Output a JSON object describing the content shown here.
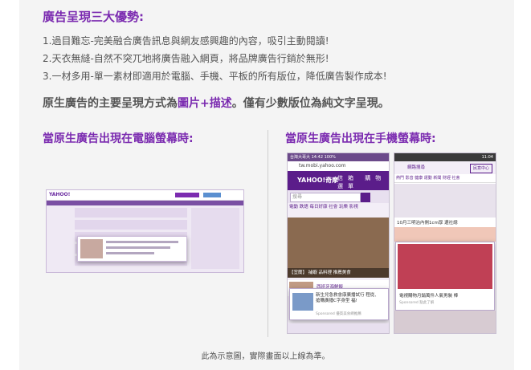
{
  "heading": "廣告呈現三大優勢:",
  "advantages": [
    "1.過目難忘-完美融合廣告訊息與網友感興趣的內容，吸引主動閱讀!",
    "2.天衣無縫-自然不突兀地將廣告融入網頁，將品牌廣告行銷於無形!",
    "3.一材多用-單一素材即適用於電腦、手機、平板的所有版位，降低廣告製作成本!"
  ],
  "summary": {
    "prefix": "原生廣告的主要呈現方式為",
    "highlight": "圖片+描述",
    "suffix": "。僅有少數版位為純文字呈現。"
  },
  "desktop_heading": "當原生廣告出現在電腦螢幕時:",
  "mobile_heading": "當原生廣告出現在手機螢幕時:",
  "footnote": "此為示意圖，實際畫面以上線為準。",
  "mock_desktop": {
    "logo": "YAHOO!"
  },
  "mock_phone1": {
    "status": "台灣大哥大 14:42 100%",
    "url": "tw.mobi.yahoo.com",
    "logo": "YAHOO!奇摩",
    "buttons": "信箱 購物 選單",
    "search_placeholder": "搜尋",
    "tabs": "電動 跌語 每日好康 社會 玩樂 影視",
    "photo_caption": "【宜蘭】 捕蝦 品料理 推薦美食",
    "item_title": "西班牙海鮮飯",
    "item_meta": "西班牙料理Foodling",
    "ad_text": "新生兒急救會康廣播試行 程從、搶購廣播C字身型 福!",
    "ad_sponsor": "Sponsored 優質美食網推薦"
  },
  "mock_phone2": {
    "status": "11:04",
    "search_placeholder": "網路搜尋",
    "login_btn": "民意中心",
    "tabs": "熱門 影音 健康 運動 新聞 財經 社會",
    "caption": "10月三明治內側1cm厚 遭社總",
    "ad_text": "電視購物月銷萬件人氣男裝 棒",
    "ad_sponsor": "Sponsored 點此了解"
  },
  "colors": {
    "accent": "#7b2bb0",
    "text": "#555555",
    "panel_bg": "#f4f4f4"
  }
}
